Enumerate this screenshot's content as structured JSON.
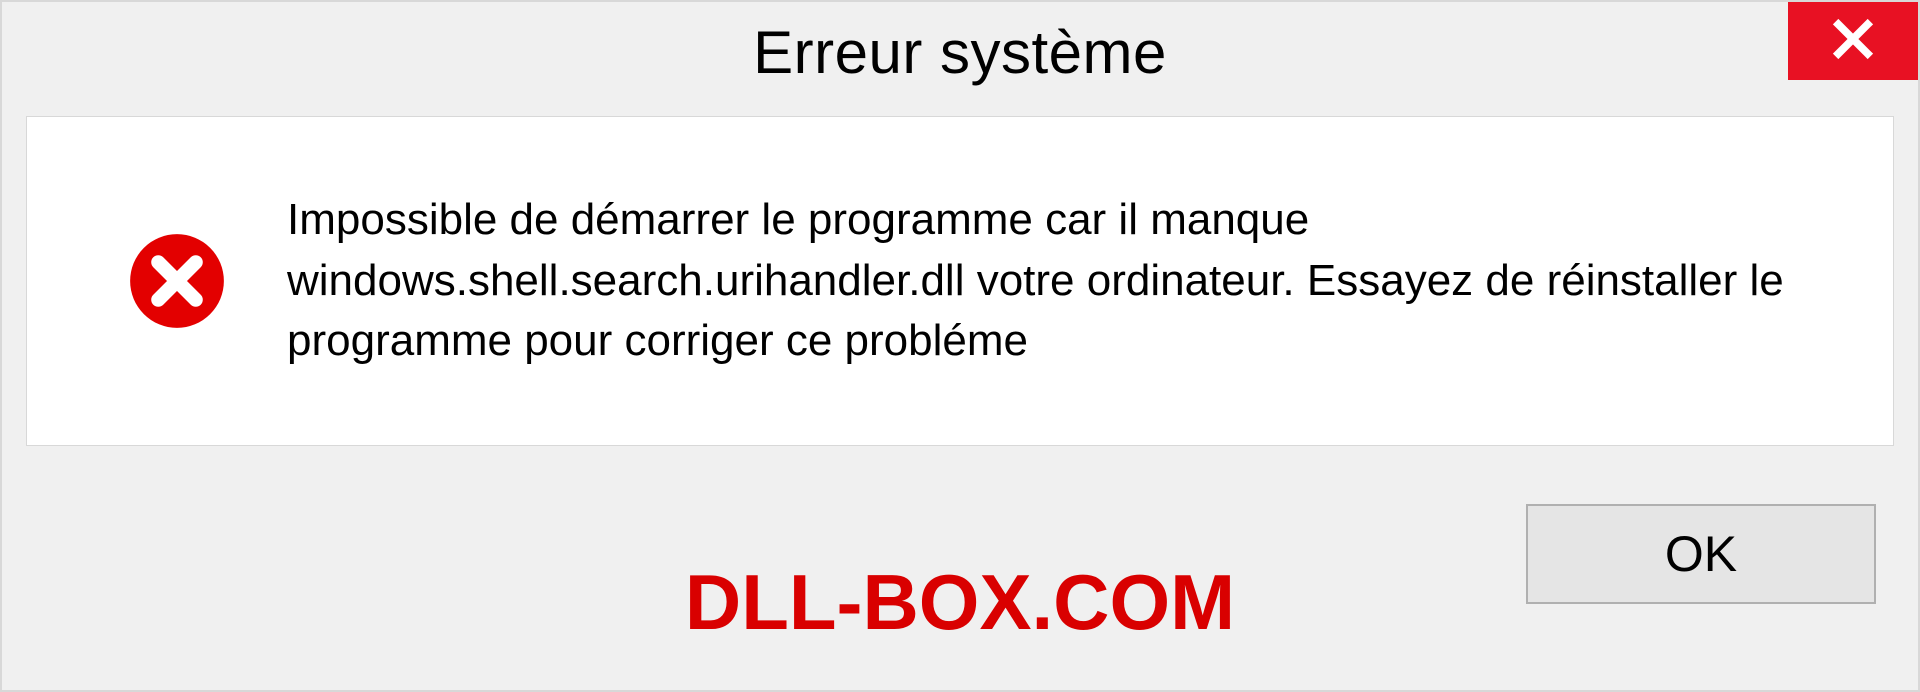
{
  "dialog": {
    "title": "Erreur système",
    "message": "Impossible de démarrer le programme car il manque windows.shell.search.urihandler.dll votre ordinateur. Essayez de réinstaller le programme pour corriger ce probléme",
    "ok_label": "OK"
  },
  "watermark": "DLL-BOX.COM"
}
